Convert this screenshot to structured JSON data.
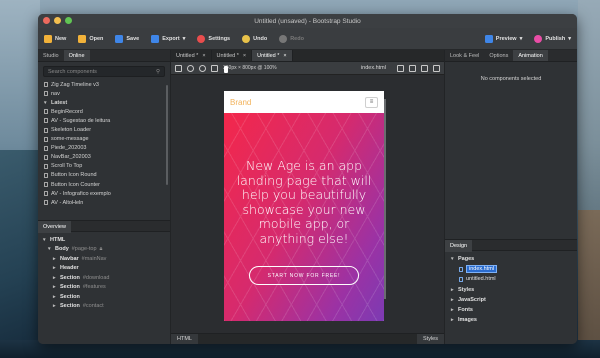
{
  "window": {
    "title": "Untitled (unsaved) - Bootstrap Studio"
  },
  "toolbar": {
    "new_label": "New",
    "open_label": "Open",
    "save_label": "Save",
    "export_label": "Export",
    "settings_label": "Settings",
    "undo_label": "Undo",
    "redo_label": "Redo",
    "preview_label": "Preview",
    "publish_label": "Publish",
    "colors": {
      "new": "#f2b23a",
      "open": "#f2b23a",
      "save": "#3f86e8",
      "export": "#3f86e8",
      "settings": "#e94d4d",
      "undo": "#e8c24a",
      "redo": "#777777",
      "preview": "#3f86e8",
      "publish": "#e94da6"
    }
  },
  "left_panel": {
    "tabs": [
      "Studio",
      "Online"
    ],
    "active_tab": "Online",
    "search_placeholder": "Search components",
    "components": [
      {
        "label": "Zig Zag Timeline v3",
        "type": "item"
      },
      {
        "label": "nav",
        "type": "item"
      },
      {
        "label": "Latest",
        "type": "group"
      },
      {
        "label": "BeginRecord",
        "type": "item"
      },
      {
        "label": "AV - Sugestao de leitura",
        "type": "item"
      },
      {
        "label": "Skeleton Loader",
        "type": "item"
      },
      {
        "label": "some-message",
        "type": "item"
      },
      {
        "label": "Piede_202003",
        "type": "item"
      },
      {
        "label": "NavBar_202003",
        "type": "item"
      },
      {
        "label": "Scroll To Top",
        "type": "item"
      },
      {
        "label": "Button Icon Round",
        "type": "item"
      },
      {
        "label": "Button Icon Counter",
        "type": "item"
      },
      {
        "label": "AV - Infografico exemplo",
        "type": "item"
      },
      {
        "label": "AV - AltoHeln",
        "type": "item"
      }
    ],
    "overview_title": "Overview",
    "overview_tree": [
      {
        "tag": "HTML",
        "attr": "",
        "level": 0,
        "open": true
      },
      {
        "tag": "Body",
        "attr": "#page-top",
        "level": 1,
        "open": true
      },
      {
        "tag": "Navbar",
        "attr": "#mainNav",
        "level": 2,
        "open": false
      },
      {
        "tag": "Header",
        "attr": "",
        "level": 2,
        "open": false
      },
      {
        "tag": "Section",
        "attr": "#download",
        "level": 2,
        "open": false
      },
      {
        "tag": "Section",
        "attr": "#features",
        "level": 2,
        "open": false
      },
      {
        "tag": "Section",
        "attr": "",
        "level": 2,
        "open": false
      },
      {
        "tag": "Section",
        "attr": "#contact",
        "level": 2,
        "open": false
      }
    ]
  },
  "center": {
    "doc_tabs": [
      {
        "label": "Untitled *",
        "active": false
      },
      {
        "label": "Untitled *",
        "active": false
      },
      {
        "label": "Untitled *",
        "active": true
      }
    ],
    "viewport_info": "360px × 800px @ 100%",
    "page_select": "index.html",
    "preview": {
      "brand": "Brand",
      "menu_glyph": "≡",
      "headline": "New Age is an app landing page that will help you beautifully showcase your new mobile app, or anything else!",
      "cta": "START NOW FOR FREE!"
    },
    "bottom_left_tab": "HTML",
    "bottom_right_tab": "Styles"
  },
  "right_panel": {
    "tabs": [
      "Look & Feel",
      "Options",
      "Animation"
    ],
    "active_tab": "Animation",
    "empty_message": "No components selected",
    "design_title": "Design",
    "design_tree": [
      {
        "label": "Pages",
        "type": "group",
        "open": true
      },
      {
        "label": "index.html",
        "type": "page",
        "selected": true
      },
      {
        "label": "untitled.html",
        "type": "page",
        "selected": false
      },
      {
        "label": "Styles",
        "type": "group",
        "open": false
      },
      {
        "label": "JavaScript",
        "type": "group",
        "open": false
      },
      {
        "label": "Fonts",
        "type": "group",
        "open": false
      },
      {
        "label": "Images",
        "type": "group",
        "open": false
      }
    ]
  }
}
